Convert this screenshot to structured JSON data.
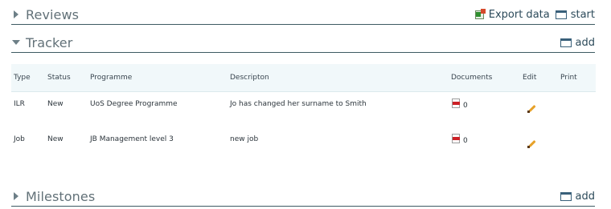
{
  "reviews": {
    "title": "Reviews",
    "export_label": "Export data",
    "start_label": "start"
  },
  "tracker": {
    "title": "Tracker",
    "add_label": "add",
    "columns": {
      "type": "Type",
      "status": "Status",
      "programme": "Programme",
      "description": "Descripton",
      "documents": "Documents",
      "edit": "Edit",
      "print": "Print"
    },
    "rows": [
      {
        "type": "ILR",
        "status": "New",
        "programme": "UoS Degree Programme",
        "description": "Jo has changed her surname to Smith",
        "documents": "0"
      },
      {
        "type": "Job",
        "status": "New",
        "programme": "JB Management level 3",
        "description": "new job",
        "documents": "0"
      }
    ]
  },
  "milestones": {
    "title": "Milestones",
    "add_label": "add"
  },
  "icons": {
    "collapsed": "triangle-right-icon",
    "expanded": "triangle-down-icon",
    "window": "window-icon",
    "export": "export-spreadsheet-icon",
    "pdf": "pdf-icon",
    "edit": "pencil-icon"
  },
  "colors": {
    "header_text": "#627178",
    "divider": "#3e5a62",
    "table_header_bg": "#f1f8fa",
    "pdf_red": "#cc2127",
    "pencil": "#e7a22a"
  }
}
